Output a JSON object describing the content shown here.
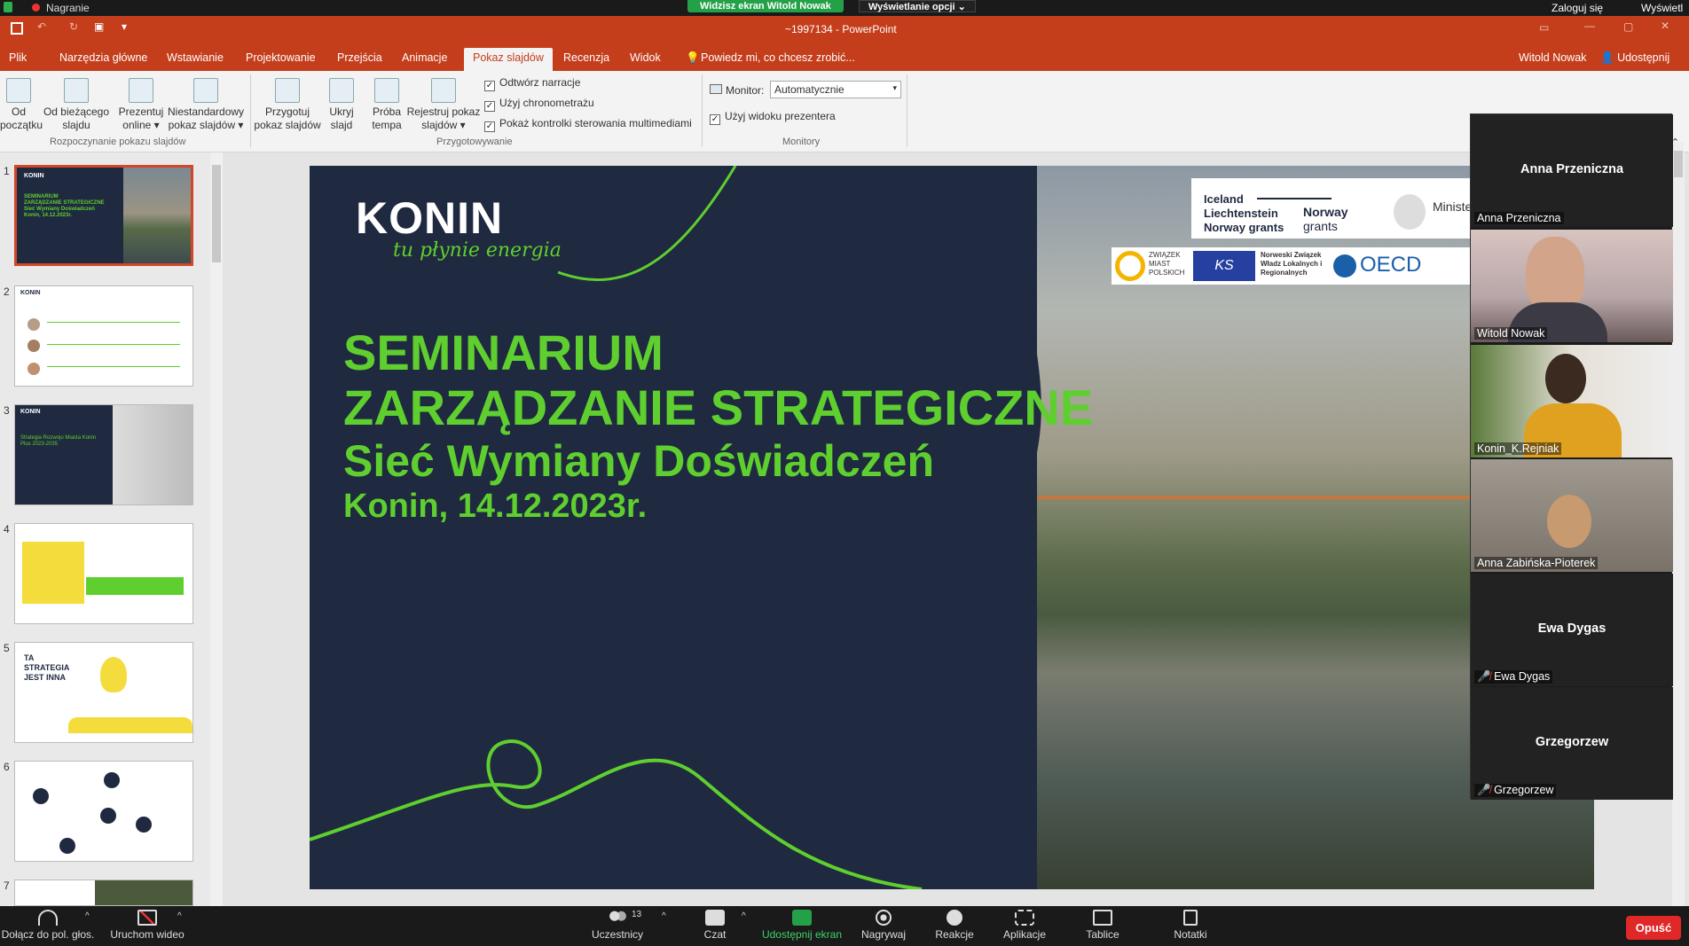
{
  "zoom_top": {
    "recording_label": "Nagranie",
    "share_notice": "Widzisz ekran Witold Nowak",
    "view_options": "Wyświetlanie opcji",
    "signed_in": "Zaloguj się",
    "display": "Wyświetl"
  },
  "pp": {
    "title": "~1997134 - PowerPoint",
    "user": "Witold Nowak",
    "share": "Udostępnij",
    "search_placeholder": "Powiedz mi, co chcesz zrobić...",
    "tabs": [
      "Plik",
      "Narzędzia główne",
      "Wstawianie",
      "Projektowanie",
      "Przejścia",
      "Animacje",
      "Pokaz slajdów",
      "Recenzja",
      "Widok"
    ],
    "active_tab_index": 6
  },
  "ribbon": {
    "buttons": [
      {
        "l1": "Od",
        "l2": "początku"
      },
      {
        "l1": "Od bieżącego",
        "l2": "slajdu"
      },
      {
        "l1": "Prezentuj",
        "l2": "online ▾"
      },
      {
        "l1": "Niestandardowy",
        "l2": "pokaz slajdów ▾"
      },
      {
        "l1": "Przygotuj",
        "l2": "pokaz slajdów"
      },
      {
        "l1": "Ukryj",
        "l2": "slajd"
      },
      {
        "l1": "Próba",
        "l2": "tempa"
      },
      {
        "l1": "Rejestruj pokaz",
        "l2": "slajdów ▾"
      }
    ],
    "group_start": "Rozpoczynanie pokazu slajdów",
    "group_prepare": "Przygotowywanie",
    "group_monitors": "Monitory",
    "checkboxes": [
      "Odtwórz narracje",
      "Użyj chronometrażu",
      "Pokaż kontrolki sterowania multimediami"
    ],
    "monitor_label": "Monitor:",
    "monitor_value": "Automatycznie",
    "presenter_view": "Użyj widoku prezentera"
  },
  "thumbs": {
    "numbers": [
      "1",
      "2",
      "3",
      "4",
      "5",
      "6",
      "7"
    ],
    "t5_text": "TA STRATEGIA JEST INNA",
    "t3_text": "Strategia Rozwoju Miasta Konin Plus 2023-2035"
  },
  "slide": {
    "logo": "KONIN",
    "tagline": "tu płynie energia",
    "line1": "SEMINARIUM",
    "line2": "ZARZĄDZANIE STRATEGICZNE",
    "line3": "Sieć Wymiany Doświadczeń",
    "line4": "Konin, 14.12.2023r.",
    "grants_1": "Iceland",
    "grants_2": "Liechtenstein",
    "grants_3": "Norway grants",
    "grants_4": "Norway",
    "grants_5": "grants",
    "ministry": "Ministe i Polityk",
    "zmp": "ZWIĄZEK MIAST POLSKICH",
    "ks": "KS",
    "nzwl": "Norweski Związek Władz Lokalnych i Regionalnych",
    "oecd": "OECD"
  },
  "gallery": [
    {
      "center": "Anna Przeniczna",
      "label": "Anna Przeniczna",
      "video": false,
      "muted": false
    },
    {
      "center": "",
      "label": "Witold Nowak",
      "video": true,
      "muted": false
    },
    {
      "center": "",
      "label": "Konin_K.Rejniak",
      "video": true,
      "muted": false
    },
    {
      "center": "",
      "label": "Anna Zabińska-Pioterek",
      "video": true,
      "muted": false
    },
    {
      "center": "Ewa Dygas",
      "label": "Ewa Dygas",
      "video": false,
      "muted": true
    },
    {
      "center": "Grzegorzew",
      "label": "Grzegorzew",
      "video": false,
      "muted": true
    }
  ],
  "zoom_bottom": {
    "audio": "Dołącz do pol. głos.",
    "video": "Uruchom wideo",
    "participants": "Uczestnicy",
    "participant_count": "13",
    "chat": "Czat",
    "share": "Udostępnij ekran",
    "record": "Nagrywaj",
    "reactions": "Reakcje",
    "apps": "Aplikacje",
    "whiteboards": "Tablice",
    "notes": "Notatki",
    "leave": "Opuść"
  },
  "colors": {
    "pp_red": "#c43e1c",
    "slide_green": "#5fcf2f",
    "slide_bg": "#1f2940",
    "zoom_green": "#24a148",
    "leave_red": "#e02828"
  }
}
